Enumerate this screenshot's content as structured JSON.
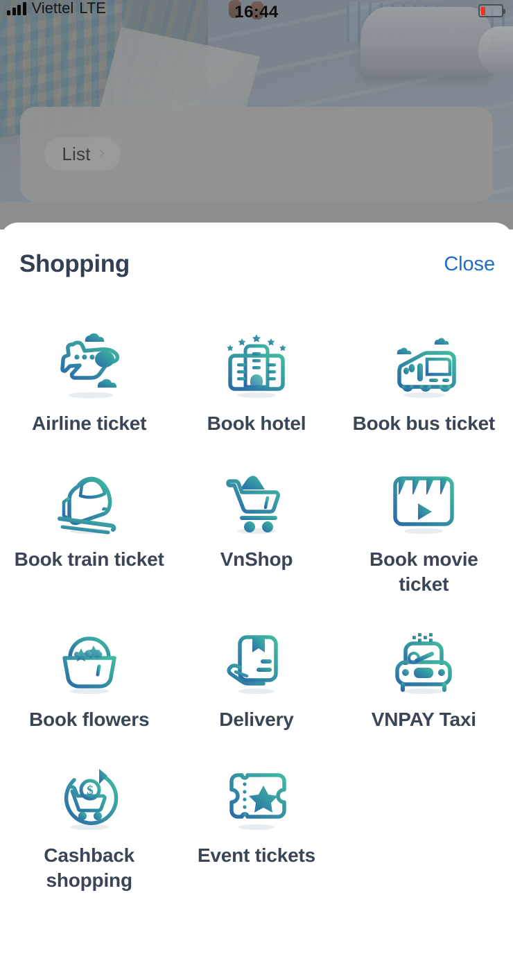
{
  "status_bar": {
    "carrier": "Viettel",
    "network": "LTE",
    "time": "16:44",
    "signal_icon": "signal-bars-icon",
    "battery_icon": "battery-low-icon",
    "battery_level_percent": 15
  },
  "background": {
    "chip_label": "List",
    "chip_icon": "chevron-right-icon"
  },
  "sheet": {
    "title": "Shopping",
    "close_label": "Close",
    "items": [
      {
        "label": "Airline ticket",
        "icon": "airplane-icon"
      },
      {
        "label": "Book hotel",
        "icon": "hotel-building-icon"
      },
      {
        "label": "Book bus ticket",
        "icon": "bus-icon"
      },
      {
        "label": "Book train ticket",
        "icon": "train-icon"
      },
      {
        "label": "VnShop",
        "icon": "shopping-cart-icon"
      },
      {
        "label": "Book movie ticket",
        "icon": "clapperboard-icon"
      },
      {
        "label": "Book flowers",
        "icon": "flower-basket-icon"
      },
      {
        "label": "Delivery",
        "icon": "parcel-hand-icon"
      },
      {
        "label": "VNPAY Taxi",
        "icon": "taxi-car-icon"
      },
      {
        "label": "Cashback shopping",
        "icon": "cashback-cart-icon"
      },
      {
        "label": "Event tickets",
        "icon": "event-ticket-icon"
      }
    ]
  },
  "colors": {
    "accent_blue": "#1f6dc4",
    "title_navy": "#333f53",
    "label_slate": "#3a4556",
    "icon_gradient_start": "#2a6aa8",
    "icon_gradient_end": "#3fba9f",
    "sheet_background": "#ffffff",
    "overlay_grey": "#929292"
  }
}
